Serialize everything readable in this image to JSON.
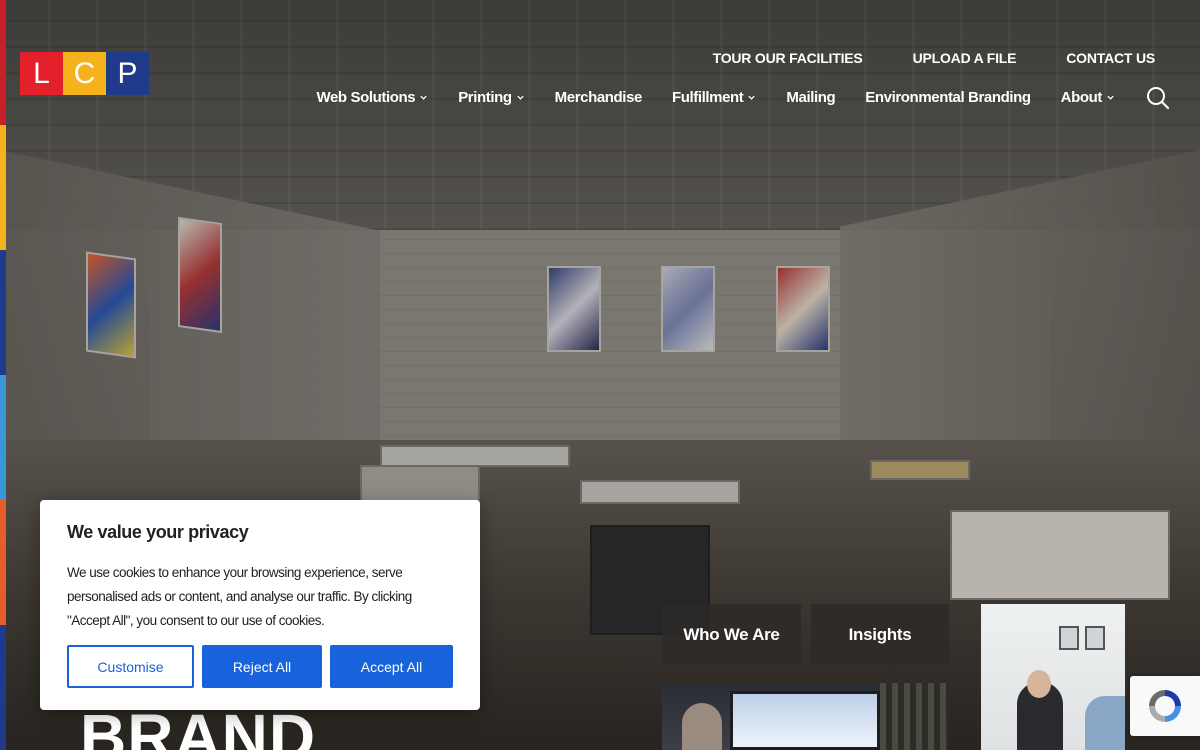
{
  "logo": {
    "letters": [
      "L",
      "C",
      "P"
    ],
    "colors": [
      "#e4202a",
      "#f6b21a",
      "#1f3a8a"
    ]
  },
  "stripe_colors": [
    "#c8202b",
    "#f5b21b",
    "#1f3a8a",
    "#3a97d4",
    "#e35e2a",
    "#1f3a8a"
  ],
  "topnav": [
    "TOUR OUR FACILITIES",
    "UPLOAD A FILE",
    "CONTACT US"
  ],
  "mainnav": [
    {
      "label": "Web Solutions",
      "dropdown": true
    },
    {
      "label": "Printing",
      "dropdown": true
    },
    {
      "label": "Merchandise",
      "dropdown": false
    },
    {
      "label": "Fulfillment",
      "dropdown": true
    },
    {
      "label": "Mailing",
      "dropdown": false
    },
    {
      "label": "Environmental Branding",
      "dropdown": false
    },
    {
      "label": "About",
      "dropdown": true
    }
  ],
  "search_icon": "search-icon",
  "hero": {
    "title": "BRAND"
  },
  "tiles": {
    "who_we_are": "Who We Are",
    "insights": "Insights"
  },
  "cookie": {
    "title": "We value your privacy",
    "body": "We use cookies to enhance your browsing experience, serve personalised ads or content, and analyse our traffic. By clicking \"Accept All\", you consent to our use of cookies.",
    "customise": "Customise",
    "reject": "Reject All",
    "accept": "Accept All"
  },
  "accent": "#1863dc"
}
